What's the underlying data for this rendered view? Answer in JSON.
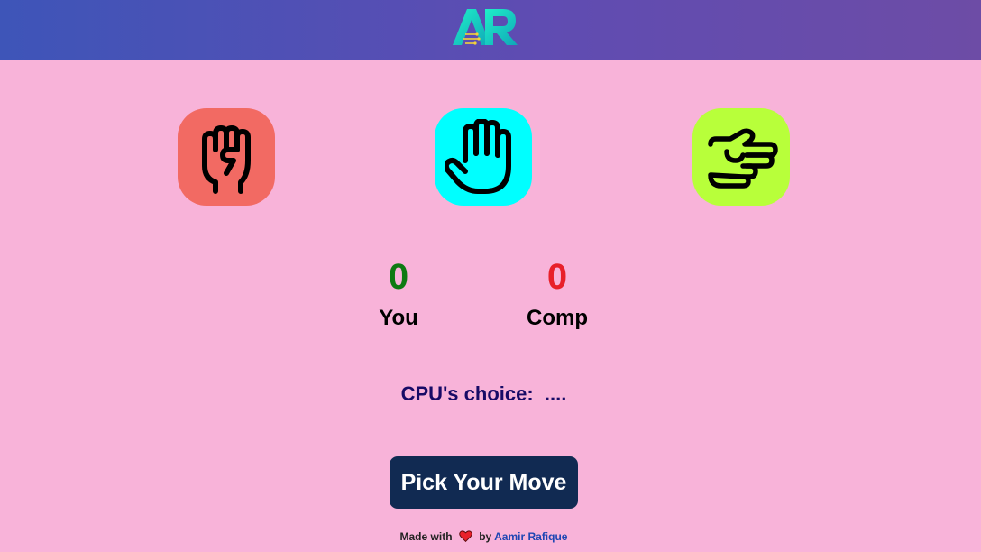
{
  "header": {
    "logo_text": "AR",
    "background_start": "#3e55b8",
    "background_end": "#6d4ca6"
  },
  "moves": [
    {
      "name": "rock",
      "icon": "fist-icon",
      "color": "#f26a63"
    },
    {
      "name": "paper",
      "icon": "open-hand-icon",
      "color": "#00ffff"
    },
    {
      "name": "scissors",
      "icon": "scissors-hand-icon",
      "color": "#b8ff3a"
    }
  ],
  "scoreboard": {
    "user_score": "0",
    "user_label": "You",
    "user_color": "#0d7a12",
    "comp_score": "0",
    "comp_label": "Comp",
    "comp_color": "#e8202a"
  },
  "cpu_choice": "CPU's choice:  ....",
  "pick_button": {
    "label": "Pick Your Move",
    "background": "#112a52"
  },
  "footer": {
    "made_with": "Made with",
    "by": "by",
    "author": "Aamir Rafique",
    "heart_color": "#e8202a"
  }
}
